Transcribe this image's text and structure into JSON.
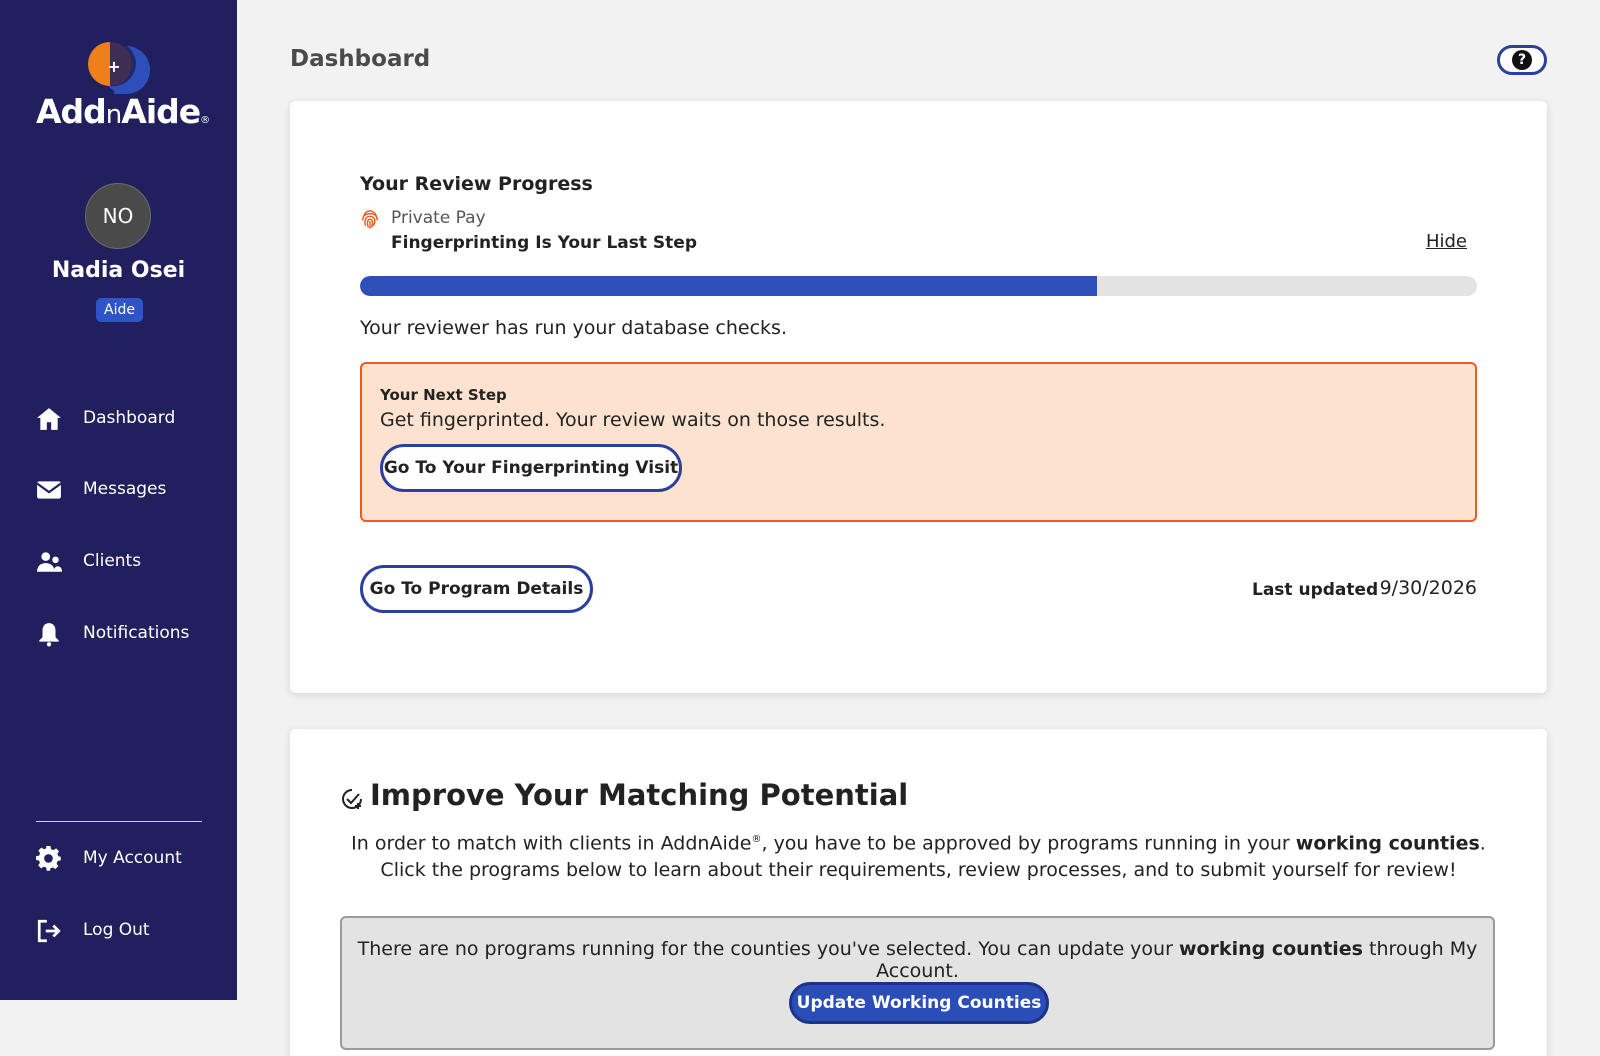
{
  "brand": {
    "name_part1": "Add",
    "name_part2": "n",
    "name_part3": "Aide",
    "registered_mark": "®",
    "colors": {
      "sidebar": "#211f5e",
      "accent": "#2f4fb8",
      "orange": "#ee7f1a",
      "alert_border": "#ee5a1f",
      "alert_bg": "#fde3cf"
    }
  },
  "user": {
    "initials": "NO",
    "name": "Nadia Osei",
    "role": "Aide"
  },
  "nav": {
    "items": [
      {
        "label": "Dashboard",
        "icon": "home-icon"
      },
      {
        "label": "Messages",
        "icon": "envelope-icon"
      },
      {
        "label": "Clients",
        "icon": "users-icon"
      },
      {
        "label": "Notifications",
        "icon": "bell-icon"
      }
    ],
    "bottom": [
      {
        "label": "My Account",
        "icon": "gear-icon"
      },
      {
        "label": "Log Out",
        "icon": "logout-icon"
      }
    ]
  },
  "header": {
    "title": "Dashboard",
    "help_symbol": "?"
  },
  "review": {
    "title": "Your Review Progress",
    "program": "Private Pay",
    "step": "Fingerprinting Is Your Last Step",
    "hide_label": "Hide",
    "progress_percent": 66,
    "status": "Your reviewer has run your database checks.",
    "next_step": {
      "heading": "Your Next Step",
      "text": "Get fingerprinted. Your review waits on those results.",
      "button": "Go To Your Fingerprinting Visit"
    },
    "program_button": "Go To Program Details",
    "last_updated_label": "Last updated",
    "last_updated_value": "9/30/2026"
  },
  "matching": {
    "title": "Improve Your Matching Potential",
    "desc_1": "In order to match with clients in AddnAide",
    "desc_reg": "®",
    "desc_2": ", you have to be approved by programs running in your ",
    "desc_bold": "working counties",
    "desc_3": ". Click the programs below to learn about their requirements, review processes, and to submit yourself for review!",
    "notice_1": "There are no programs running for the counties you've selected. You can update your ",
    "notice_bold": "working counties",
    "notice_2": " through My Account.",
    "update_button": "Update Working Counties"
  }
}
